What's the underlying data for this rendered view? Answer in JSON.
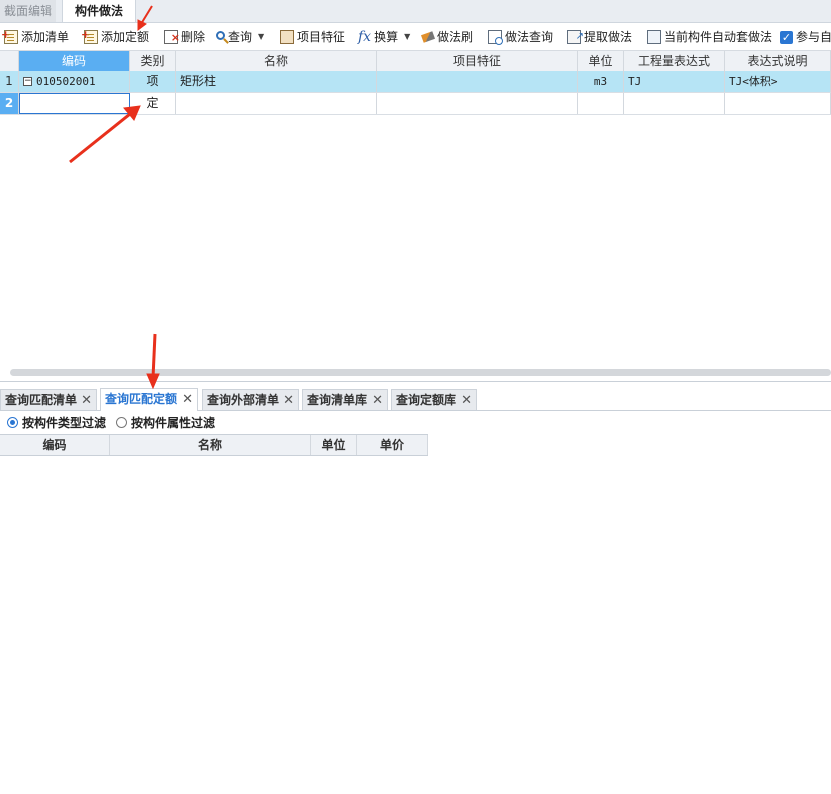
{
  "top_tabs": [
    {
      "label": "截面编辑",
      "active": false
    },
    {
      "label": "构件做法",
      "active": true
    }
  ],
  "toolbar": {
    "add_list": "添加清单",
    "add_quota": "添加定额",
    "delete": "删除",
    "query": "查询",
    "item_feature": "项目特征",
    "convert": "换算",
    "method_brush": "做法刷",
    "method_query": "做法查询",
    "extract_method": "提取做法",
    "auto_apply": "当前构件自动套做法",
    "participate": "参与自"
  },
  "grid": {
    "columns": [
      "编码",
      "类别",
      "名称",
      "项目特征",
      "单位",
      "工程量表达式",
      "表达式说明"
    ],
    "rows": [
      {
        "num": "1",
        "code": "010502001",
        "type": "项",
        "name": "矩形柱",
        "feature": "",
        "unit": "m3",
        "expr": "TJ",
        "desc": "TJ<体积>"
      },
      {
        "num": "2",
        "code": "",
        "type": "定",
        "name": "",
        "feature": "",
        "unit": "",
        "expr": "",
        "desc": ""
      }
    ]
  },
  "bottom_tabs": [
    {
      "label": "查询匹配清单",
      "active": false
    },
    {
      "label": "查询匹配定额",
      "active": true
    },
    {
      "label": "查询外部清单",
      "active": false
    },
    {
      "label": "查询清单库",
      "active": false
    },
    {
      "label": "查询定额库",
      "active": false
    }
  ],
  "filters": {
    "by_type": "按构件类型过滤",
    "by_attr": "按构件属性过滤",
    "selected": "by_type"
  },
  "lower_columns": [
    "编码",
    "名称",
    "单位",
    "单价"
  ],
  "colors": {
    "accent": "#2a76d2",
    "selected_row": "#b6e4f5",
    "header_selected": "#5aaef2",
    "annotation_arrow": "#e8301c"
  }
}
